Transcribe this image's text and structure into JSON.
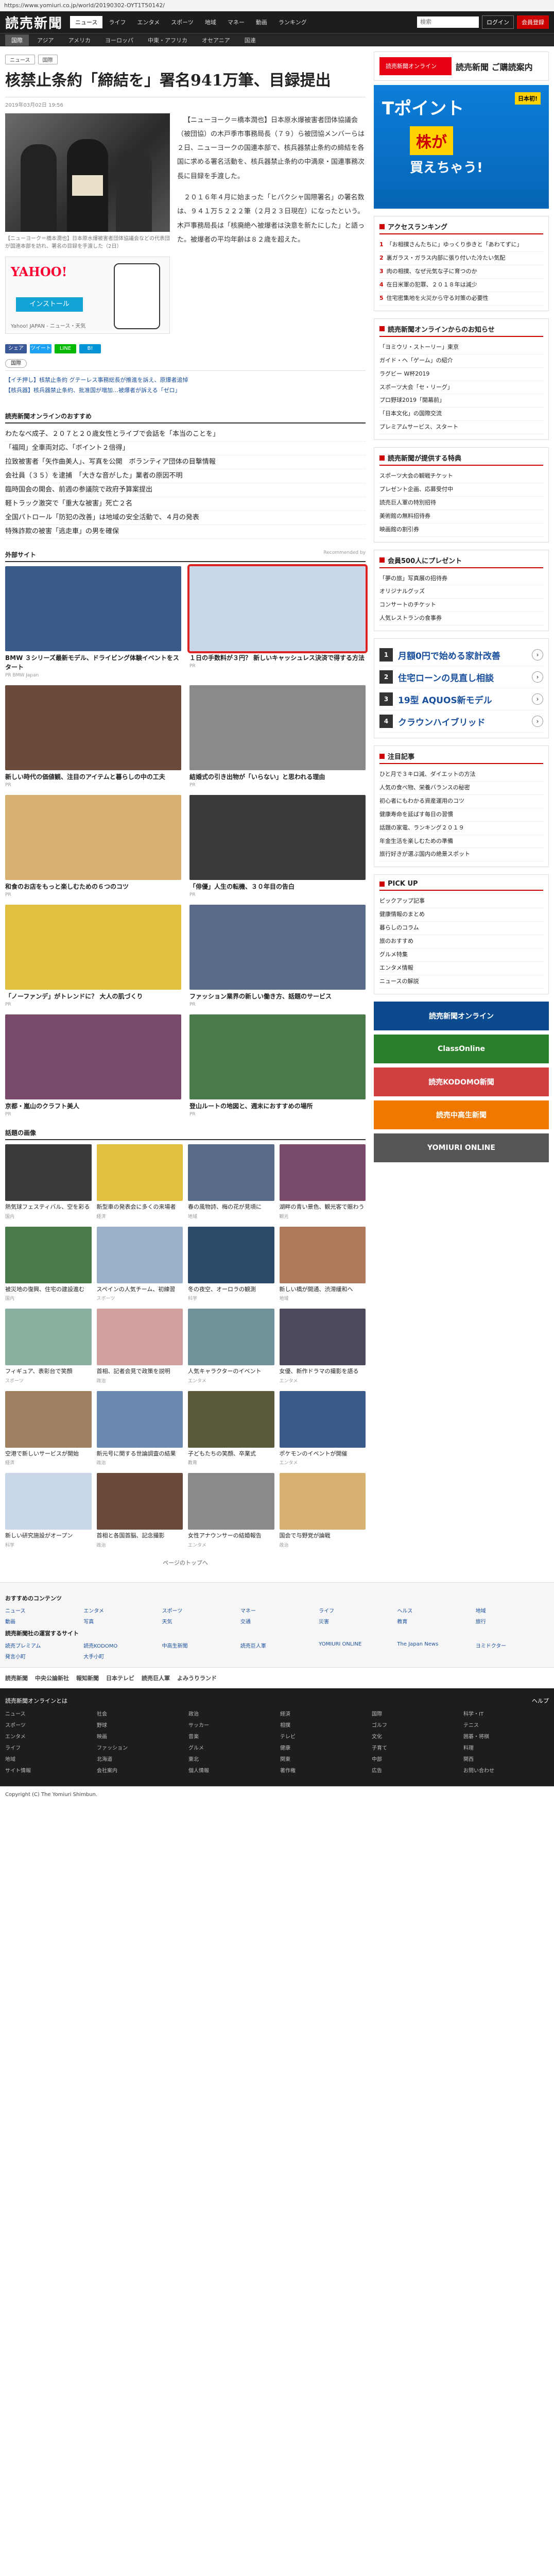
{
  "browser": {
    "url": "https://www.yomiuri.co.jp/world/20190302-OYT1T50142/"
  },
  "header": {
    "logo": "読売新聞",
    "nav": [
      "ニュース",
      "ライフ",
      "エンタメ",
      "スポーツ",
      "地域",
      "マネー",
      "動画",
      "ランキング"
    ],
    "subnav": [
      "国際",
      "アジア",
      "アメリカ",
      "ヨーロッパ",
      "中東・アフリカ",
      "オセアニア",
      "国連"
    ],
    "login": "ログイン",
    "register": "会員登録",
    "search_placeholder": "検索"
  },
  "crumbs": [
    "ニュース",
    "国際"
  ],
  "article": {
    "title": "核禁止条約「締結を」署名941万筆、目録提出",
    "date": "2019年03月02日 19:56",
    "caption": "【ニューヨーク＝橋本潤也】日本原水爆被害者団体協議会などの代表団が国連本部を訪れ、署名の目録を手渡した（2日）",
    "paragraphs": [
      "【ニューヨーク＝橋本潤也】日本原水爆被害者団体協議会（被団協）の木戸季市事務局長（７９）ら被団協メンバーらは２日、ニューヨークの国連本部で、核兵器禁止条約の締結を各国に求める署名活動を、核兵器禁止条約の中満泉・国連事務次長に目録を手渡した。",
      "２０１６年４月に始まった「ヒバクシャ国際署名」の署名数は、９４１万５２２２筆（２月２３日現在）になったという。木戸事務局長は「核廃絶へ被爆者は決意を新たにした」と語った。被爆者の平均年齢は８２歳を超えた。"
    ],
    "yahoo_ad": {
      "logo": "YAHOO!",
      "install": "インストール",
      "caption": "Yahoo! JAPAN - ニュース・天気"
    },
    "share": [
      "シェア",
      "ツイート",
      "LINE",
      "B!"
    ],
    "tag": "国際",
    "related": [
      "【イチ押し】核禁止条約 グテーレス事務総長が推進を訴え、原爆者追悼",
      "【核兵器】核兵器禁止条約、批准国が増加…被爆者が訴える「ゼロ」"
    ]
  },
  "news_list": {
    "heading": "読売新聞オンラインのおすすめ",
    "items": [
      "わたなべ成子、２０７と２０歳女性とライブで会話を「本当のことを」",
      "「福岡」全車両対応、「ボイント２倍得」",
      "拉致被害者「矢作曲美人」、写真を公開　ボランティア団体の目撃情報",
      "会社員（３５）を逮捕　「大きな音がした」業者の原因不明",
      "臨時国会の開会、前週の参議院で政府予算案提出",
      "軽トラック激突で「重大な被害」死亡２名",
      "全国パトロール「防犯の改善」は地域の安全活動で、４月の発表",
      "特殊詐欺の被害「逃走車」の男を確保"
    ]
  },
  "recommend": {
    "heading": "外部サイト",
    "cards": [
      {
        "t": "BMW ３シリーズ最新モデル、ドライビング体験イベントをスタート",
        "s": "PR BMW Japan"
      },
      {
        "t": "１日の手数料が３円？ 新しいキャッシュレス決済で得する方法",
        "s": "PR"
      },
      {
        "t": "新しい時代の価値観、注目のアイテムと暮らしの中の工夫",
        "s": "PR"
      },
      {
        "t": "結婚式の引き出物が「いらない」と思われる理由",
        "s": "PR"
      },
      {
        "t": "和食のお店をもっと楽しむための６つのコツ",
        "s": "PR"
      },
      {
        "t": "「俳優」人生の転機、３０年目の告白",
        "s": "PR"
      },
      {
        "t": "「ノーファンデ」がトレンドに？ 大人の肌づくり",
        "s": "PR"
      },
      {
        "t": "ファッション業界の新しい働き方、話題のサービス",
        "s": "PR"
      },
      {
        "t": "京都・嵐山のクラフト美人",
        "s": "PR"
      },
      {
        "t": "登山ルートの地図と、週末におすすめの場所",
        "s": "PR"
      }
    ]
  },
  "ranking_grid": {
    "heading": "話題の画像",
    "cards": [
      {
        "t": "熱気球フェスティバル、空を彩る",
        "s": "国内"
      },
      {
        "t": "新型車の発表会に多くの来場者",
        "s": "経済"
      },
      {
        "t": "春の風物詩、梅の花が見頃に",
        "s": "地域"
      },
      {
        "t": "湖畔の青い景色、観光客で賑わう",
        "s": "観光"
      },
      {
        "t": "被災地の復興、住宅の建設進む",
        "s": "国内"
      },
      {
        "t": "スペインの人気チーム、初練習",
        "s": "スポーツ"
      },
      {
        "t": "冬の夜空、オーロラの観測",
        "s": "科学"
      },
      {
        "t": "新しい橋が開通、渋滞緩和へ",
        "s": "地域"
      },
      {
        "t": "フィギュア、表彰台で笑顔",
        "s": "スポーツ"
      },
      {
        "t": "首相、記者会見で政策を説明",
        "s": "政治"
      },
      {
        "t": "人気キャラクターのイベント",
        "s": "エンタメ"
      },
      {
        "t": "女優、新作ドラマの撮影を語る",
        "s": "エンタメ"
      },
      {
        "t": "空港で新しいサービスが開始",
        "s": "経済"
      },
      {
        "t": "新元号に関する世論調査の結果",
        "s": "政治"
      },
      {
        "t": "子どもたちの笑顔、卒業式",
        "s": "教育"
      },
      {
        "t": "ポケモンのイベントが開催",
        "s": "エンタメ"
      },
      {
        "t": "新しい研究施設がオープン",
        "s": "科学"
      },
      {
        "t": "首相と各国首脳、記念撮影",
        "s": "政治"
      },
      {
        "t": "女性アナウンサーの結婚報告",
        "s": "エンタメ"
      },
      {
        "t": "国会で与野党が論戦",
        "s": "政治"
      }
    ]
  },
  "pager": "ページのトップへ",
  "sidebar": {
    "premium": {
      "badge": "読売新聞オンライン",
      "title": "読売新聞 ご購読案内"
    },
    "tpoint": {
      "tag": "日本初!",
      "big": "Tポイント",
      "yel": "株が",
      "sub": "買えちゃう!"
    },
    "access_heading": "アクセスランキング",
    "access": [
      "「お相撲さんたちに」ゆっくり歩きと「あわてずに」",
      "裏ガラス・ガラス内部に張り付いた冷たい気配",
      "肉の相撲、なぜ元気な子に育つのか",
      "在日米軍の犯罪、２０１８年は減少",
      "住宅密集地を火災から守る対策の必要性"
    ],
    "yomiuri_heading": "読売新聞オンラインからのお知らせ",
    "yomiuri": [
      "「ヨミウリ・ストーリー」東京",
      "ガイド・ヘ「ゲーム」の紹介",
      "ラグビー W杯2019",
      "スポーツ大会「セ・リーグ」",
      "プロ野球2019「開幕前」",
      "「日本文化」の国際交流",
      "プレミアムサービス、スタート"
    ],
    "points_heading": "読売新聞が提供する特典",
    "points": [
      "スポーツ大会の観戦チケット",
      "プレゼント企画、応募受付中",
      "読売巨人軍の特別招待",
      "美術館の無料招待券",
      "映画館の割引券"
    ],
    "gift_heading": "会員500人にプレゼント",
    "gifts": [
      "「夢の旅」写真展の招待券",
      "オリジナルグッズ",
      "コンサートのチケット",
      "人気レストランの食事券"
    ],
    "ads": [
      {
        "num": "1",
        "t": "月額0円で始める家計改善"
      },
      {
        "num": "2",
        "t": "住宅ローンの見直し相談"
      },
      {
        "num": "3",
        "t": "19型 AQUOS新モデル"
      },
      {
        "num": "4",
        "t": "クラウンハイブリッド"
      }
    ],
    "featured_heading": "注目記事",
    "featured": [
      "ひと月で３キロ減、ダイエットの方法",
      "人気の食べ物、栄養バランスの秘密",
      "初心者にもわかる資産運用のコツ",
      "健康寿命を延ばす毎日の習慣",
      "話題の家電、ランキング２０１９",
      "年金生活を楽しむための準備",
      "旅行好きが選ぶ国内の絶景スポット"
    ],
    "pickup_heading": "PICK UP",
    "pickup": [
      "ピックアップ記事",
      "健康情報のまとめ",
      "暮らしのコラム",
      "旅のおすすめ",
      "グルメ特集",
      "エンタメ情報",
      "ニュースの解説"
    ],
    "banners": [
      {
        "t": "読売新聞オンライン",
        "c": "#0b4a8f"
      },
      {
        "t": "ClassOnline",
        "c": "#2a7f2a"
      },
      {
        "t": "読売KODOMO新聞",
        "c": "#d04040"
      },
      {
        "t": "読売中高生新聞",
        "c": "#f07800"
      },
      {
        "t": "YOMIURI ONLINE",
        "c": "#555"
      }
    ]
  },
  "footer": {
    "recommend_heading": "おすすめのコンテンツ",
    "recommend": [
      "ニュース",
      "エンタメ",
      "スポーツ",
      "マネー",
      "ライフ",
      "ヘルス",
      "地域",
      "動画",
      "写真",
      "天気",
      "交通",
      "災害",
      "教育",
      "旅行"
    ],
    "news_heading": "読売新聞社の運営するサイト",
    "news": [
      "読売プレミアム",
      "読売KODOMO",
      "中高生新聞",
      "読売巨人軍",
      "YOMIURI ONLINE",
      "The Japan News",
      "ヨミドクター",
      "発言小町",
      "大手小町"
    ],
    "brands": [
      "読売新聞",
      "中央公論新社",
      "報知新聞",
      "日本テレビ",
      "読売巨人軍",
      "よみうりランド"
    ],
    "dark_head": "読売新聞オンラインとは",
    "dark_help": "ヘルプ",
    "dark_cols": [
      "ニュース",
      "社会",
      "政治",
      "経済",
      "国際",
      "科学・IT",
      "スポーツ",
      "野球",
      "サッカー",
      "相撲",
      "ゴルフ",
      "テニス",
      "エンタメ",
      "映画",
      "音楽",
      "テレビ",
      "文化",
      "囲碁・将棋",
      "ライフ",
      "ファッション",
      "グルメ",
      "健康",
      "子育て",
      "料理",
      "地域",
      "北海道",
      "東北",
      "関東",
      "中部",
      "関西",
      "サイト情報",
      "会社案内",
      "個人情報",
      "著作権",
      "広告",
      "お問い合わせ"
    ],
    "copyright": "Copyright (C) The Yomiuri Shimbun."
  }
}
